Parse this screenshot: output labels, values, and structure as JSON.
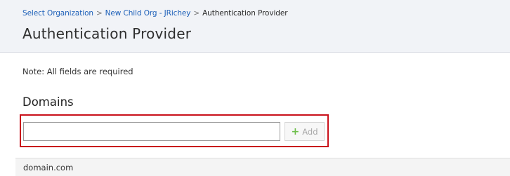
{
  "breadcrumb": {
    "items": [
      "Select Organization",
      "New Child Org - JRichey",
      "Authentication Provider"
    ],
    "separator": ">"
  },
  "page": {
    "title": "Authentication Provider",
    "note": "Note: All fields are required"
  },
  "domains": {
    "heading": "Domains",
    "input_value": "",
    "add_label": "Add",
    "list": [
      "domain.com"
    ]
  },
  "colors": {
    "header_bg": "#f1f3f7",
    "link": "#1c5fb8",
    "highlight_border": "#c9111b",
    "plus_icon": "#6fbf4c"
  },
  "icons": {
    "add": "plus-icon"
  }
}
